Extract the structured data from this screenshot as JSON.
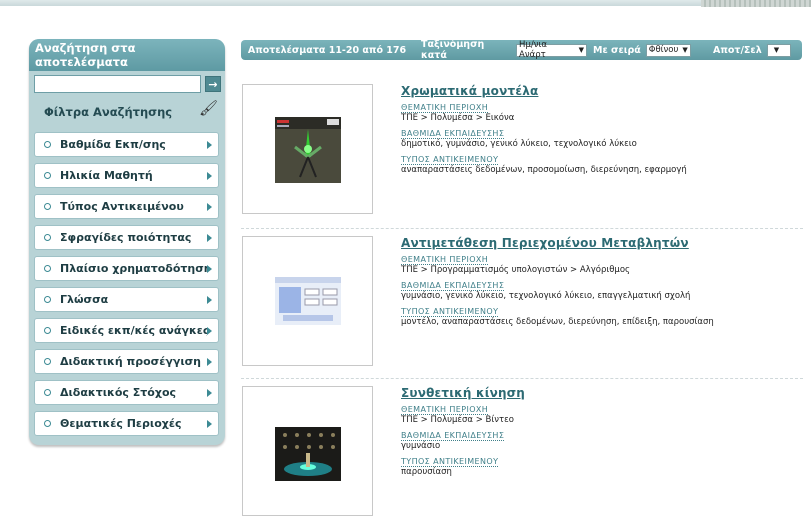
{
  "sidebar": {
    "title": "Αναζήτηση στα αποτελέσματα",
    "search": {
      "value": "",
      "placeholder": ""
    },
    "go_label": "→",
    "filters_title": "Φίλτρα Αναζήτησης",
    "filters": [
      {
        "label": "Βαθμίδα Εκπ/σης"
      },
      {
        "label": "Ηλικία Μαθητή"
      },
      {
        "label": "Τύπος Αντικειμένου"
      },
      {
        "label": "Σφραγίδες ποιότητας"
      },
      {
        "label": "Πλαίσιο χρηματοδότησης"
      },
      {
        "label": "Γλώσσα"
      },
      {
        "label": "Ειδικές εκπ/κές ανάγκες"
      },
      {
        "label": "Διδακτική προσέγγιση"
      },
      {
        "label": "Διδακτικός Στόχος"
      },
      {
        "label": "Θεματικές Περιοχές"
      }
    ]
  },
  "results_bar": {
    "range_text": "Αποτελέσματα 11-20 από 176",
    "sort_label": "Ταξινόμηση κατά",
    "sort_value": "Ημ/νια Ανάρτ",
    "order_label": "Με σειρά",
    "order_value": "Φθίνου",
    "per_page_label": "Αποτ/Σελ",
    "per_page_value": ""
  },
  "results": [
    {
      "title": "Χρωματικά μοντέλα",
      "cap1": "ΘΕΜΑΤΙΚΗ ΠΕΡΙΟΧΗ",
      "val1": "ΤΠΕ > Πολυμέσα > Εικόνα",
      "cap2": "ΒΑΘΜΙΔΑ ΕΚΠΑΙΔΕΥΣΗΣ",
      "val2": "δημοτικό, γυμνάσιο, γενικό λύκειο, τεχνολογικό λύκειο",
      "cap3": "ΤΥΠΟΣ ΑΝΤΙΚΕΙΜΕΝΟΥ",
      "val3": "αναπαραστάσεις δεδομένων, προσομοίωση, διερεύνηση, εφαρμογή"
    },
    {
      "title": "Αντιμετάθεση Περιεχομένου Μεταβλητών",
      "cap1": "ΘΕΜΑΤΙΚΗ ΠΕΡΙΟΧΗ",
      "val1": "ΤΠΕ > Προγραμματισμός υπολογιστών > Αλγόριθμος",
      "cap2": "ΒΑΘΜΙΔΑ ΕΚΠΑΙΔΕΥΣΗΣ",
      "val2": "γυμνάσιο, γενικό λύκειο, τεχνολογικό λύκειο, επαγγελματική σχολή",
      "cap3": "ΤΥΠΟΣ ΑΝΤΙΚΕΙΜΕΝΟΥ",
      "val3": "μοντέλο, αναπαραστάσεις δεδομένων, διερεύνηση, επίδειξη, παρουσίαση"
    },
    {
      "title": "Συνθετική κίνηση",
      "cap1": "ΘΕΜΑΤΙΚΗ ΠΕΡΙΟΧΗ",
      "val1": "ΤΠΕ > Πολυμέσα > Βίντεο",
      "cap2": "ΒΑΘΜΙΔΑ ΕΚΠΑΙΔΕΥΣΗΣ",
      "val2": "γυμνάσιο",
      "cap3": "ΤΥΠΟΣ ΑΝΤΙΚΕΙΜΕΝΟΥ",
      "val3": "παρουσίαση"
    }
  ]
}
